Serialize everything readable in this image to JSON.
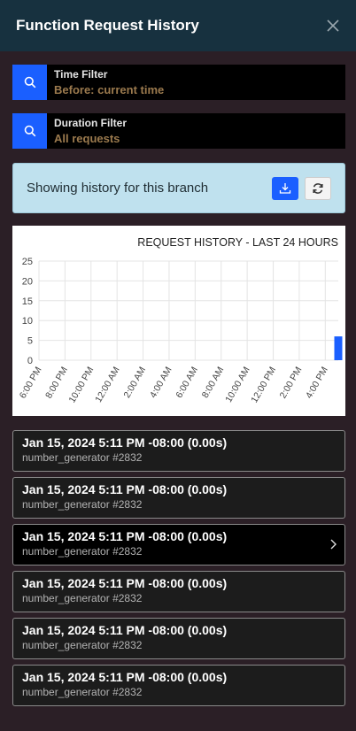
{
  "header": {
    "title": "Function Request History"
  },
  "filters": [
    {
      "label": "Time Filter",
      "value": "Before: current time"
    },
    {
      "label": "Duration Filter",
      "value": "All requests"
    }
  ],
  "banner": {
    "message": "Showing history for this branch"
  },
  "chart_data": {
    "type": "bar",
    "title": "REQUEST HISTORY - LAST 24 HOURS",
    "xlabel": "",
    "ylabel": "",
    "ylim": [
      0,
      25
    ],
    "yticks": [
      0,
      5,
      10,
      15,
      20,
      25
    ],
    "categories": [
      "6:00 PM",
      "8:00 PM",
      "10:00 PM",
      "12:00 AM",
      "2:00 AM",
      "4:00 AM",
      "6:00 AM",
      "8:00 AM",
      "10:00 AM",
      "12:00 PM",
      "2:00 PM",
      "4:00 PM"
    ],
    "bars": [
      {
        "x": "5:00 PM",
        "value": 6
      }
    ],
    "grid": true,
    "bar_color": "#1a5fff"
  },
  "requests": [
    {
      "time": "Jan 15, 2024 5:11 PM -08:00 (0.00s)",
      "function": "number_generator #2832",
      "selected": false
    },
    {
      "time": "Jan 15, 2024 5:11 PM -08:00 (0.00s)",
      "function": "number_generator #2832",
      "selected": false
    },
    {
      "time": "Jan 15, 2024 5:11 PM -08:00 (0.00s)",
      "function": "number_generator #2832",
      "selected": true
    },
    {
      "time": "Jan 15, 2024 5:11 PM -08:00 (0.00s)",
      "function": "number_generator #2832",
      "selected": false
    },
    {
      "time": "Jan 15, 2024 5:11 PM -08:00 (0.00s)",
      "function": "number_generator #2832",
      "selected": false
    },
    {
      "time": "Jan 15, 2024 5:11 PM -08:00 (0.00s)",
      "function": "number_generator #2832",
      "selected": false
    }
  ]
}
